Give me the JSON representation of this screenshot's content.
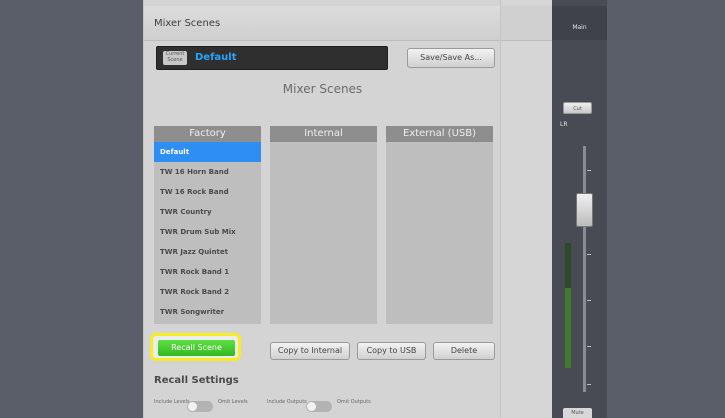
{
  "panel": {
    "title": "Mixer Scenes",
    "current_scene": {
      "chip_label": "Current Scene",
      "name": "Default"
    },
    "save_button": "Save/Save As...",
    "heading": "Mixer Scenes"
  },
  "columns": {
    "factory": {
      "header": "Factory",
      "items": [
        "Default",
        "TW 16 Horn Band",
        "TW 16 Rock Band",
        "TWR Country",
        "TWR Drum Sub Mix",
        "TWR Jazz Quintet",
        "TWR Rock Band 1",
        "TWR Rock Band 2",
        "TWR Songwriter"
      ],
      "selected_index": 0
    },
    "internal": {
      "header": "Internal"
    },
    "external": {
      "header": "External (USB)"
    }
  },
  "actions": {
    "recall": "Recall Scene",
    "copy_internal": "Copy to Internal",
    "copy_usb": "Copy to USB",
    "delete": "Delete"
  },
  "recall_settings": {
    "title": "Recall Settings",
    "options": [
      {
        "label_on": "Include Levels",
        "label_off": "Omit Levels"
      },
      {
        "label_on": "Include Outputs",
        "label_off": "Omit Outputs"
      }
    ]
  },
  "channel_strip": {
    "title": "Main",
    "button": "Cut",
    "label": "LR",
    "bottom_button": "Mute"
  },
  "colors": {
    "selected_item": "#2e8ef3",
    "scene_name": "#2aa4ff",
    "recall_button": "#3fc52a",
    "highlight": "#f5ec22"
  }
}
